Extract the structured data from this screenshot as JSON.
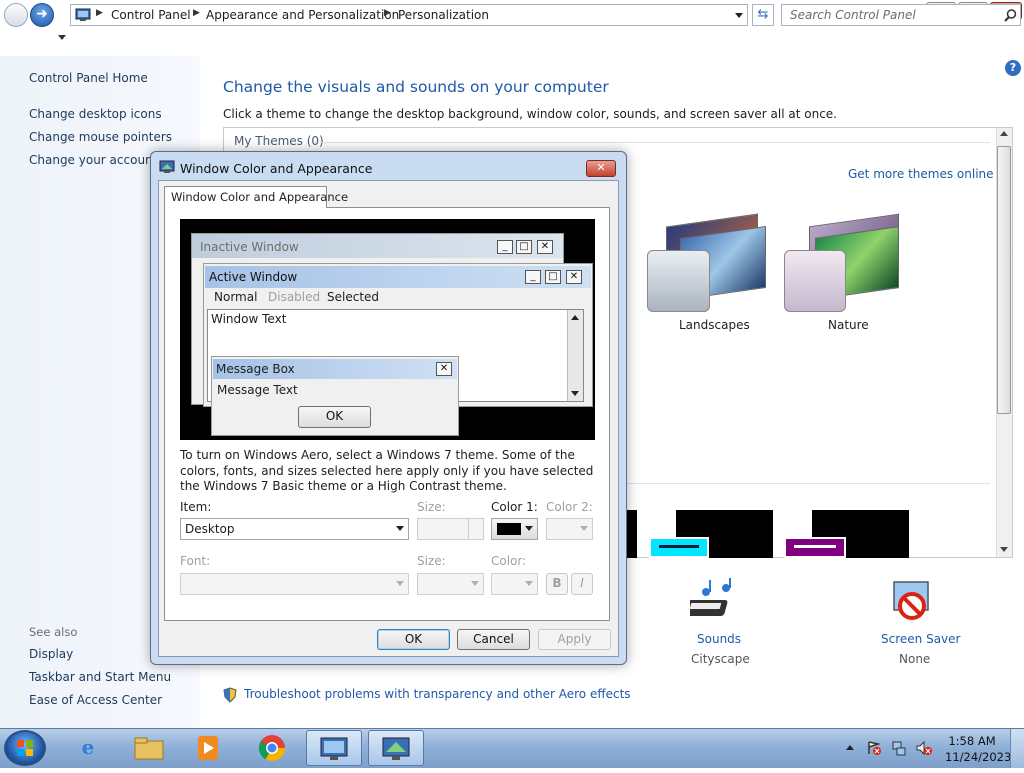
{
  "window": {
    "caption_buttons": {
      "minimize": "—",
      "maximize": "❐",
      "close": "✕"
    }
  },
  "address": {
    "breadcrumbs": [
      "Control Panel",
      "Appearance and Personalization",
      "Personalization"
    ],
    "search_placeholder": "Search Control Panel"
  },
  "left_pane": {
    "home": "Control Panel Home",
    "links": [
      "Change desktop icons",
      "Change mouse pointers",
      "Change your account p"
    ],
    "see_also_label": "See also",
    "see_also": [
      "Display",
      "Taskbar and Start Menu",
      "Ease of Access Center"
    ]
  },
  "main": {
    "title": "Change the visuals and sounds on your computer",
    "description": "Click a theme to change the desktop background, window color, sounds, and screen saver all at once.",
    "my_themes": "My Themes (0)",
    "get_more": "Get more themes online",
    "themes": [
      "Landscapes",
      "Nature"
    ],
    "bottom": [
      {
        "label": "Sounds",
        "sub": "Cityscape"
      },
      {
        "label": "Screen Saver",
        "sub": "None"
      }
    ],
    "troubleshoot": "Troubleshoot problems with transparency and other Aero effects"
  },
  "dialog": {
    "title": "Window Color and Appearance",
    "tab": "Window Color and Appearance",
    "preview": {
      "inactive": "Inactive Window",
      "active": "Active Window",
      "menu": [
        "Normal",
        "Disabled",
        "Selected"
      ],
      "window_text": "Window Text",
      "msgbox_title": "Message Box",
      "msgbox_text": "Message Text",
      "msgbox_ok": "OK"
    },
    "info_text": "To turn on Windows Aero, select a Windows 7 theme.  Some of the colors, fonts, and sizes selected here apply only if you have selected the Windows 7 Basic theme or a High Contrast theme.",
    "labels": {
      "item": "Item:",
      "size": "Size:",
      "color1": "Color 1:",
      "color2": "Color 2:",
      "font": "Font:",
      "size2": "Size:",
      "color": "Color:",
      "bold": "B",
      "italic": "I"
    },
    "item_value": "Desktop",
    "buttons": {
      "ok": "OK",
      "cancel": "Cancel",
      "apply": "Apply"
    }
  },
  "taskbar": {
    "time": "1:58 AM",
    "date": "11/24/2023"
  }
}
